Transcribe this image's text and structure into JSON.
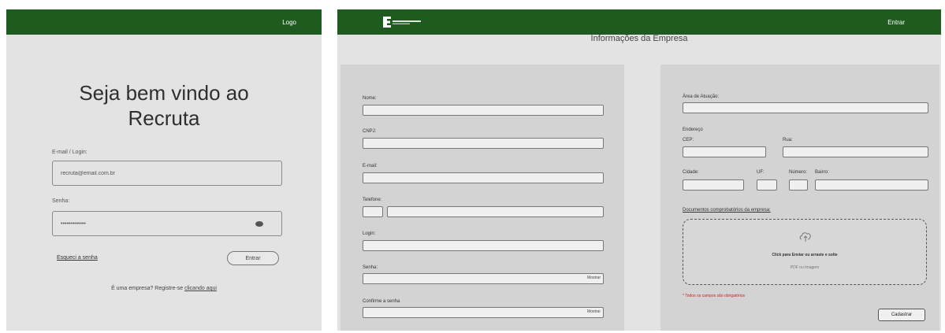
{
  "login": {
    "header": {
      "logo_label": "Logo"
    },
    "welcome": {
      "line1": "Seja bem vindo ao",
      "line2": "Recruta"
    },
    "email_label": "E-mail / Login:",
    "email_value": "recruta@email.com.br",
    "password_label": "Senha:",
    "password_value": "•••••••••••••",
    "forgot_label": "Esqueci a senha",
    "enter_label": "Entrar",
    "register_text": "É uma empresa? Registre-se",
    "register_link": "clicando aqui",
    "eye_icon": "eye-icon"
  },
  "company": {
    "header": {
      "enter_label": "Entrar",
      "brand_icon": "institution-logo-icon"
    },
    "title": "Informações da Empresa",
    "left_panel": {
      "name_label": "Nome:",
      "cnpj_label": "CNPJ:",
      "email_label": "E-mail:",
      "phone_label": "Telefone:",
      "login_label": "Login:",
      "password_label": "Senha:",
      "password_toggle": "Mostrar",
      "confirm_label": "Confirme a senha",
      "confirm_toggle": "Mostrar"
    },
    "right_panel": {
      "area_label": "Área de Atuação:",
      "address_label": "Endereço",
      "cep_label": "CEP:",
      "street_label": "Rua:",
      "city_label": "Cidade:",
      "uf_label": "UF:",
      "number_label": "Número:",
      "district_label": "Bairro:",
      "docs_label": "Documentos comprobatórios da empresa:",
      "upload_main": "Click para Enviar ou arraste e solte",
      "upload_sub": "PDF ou Imagem",
      "upload_icon": "upload-cloud-icon",
      "required_note": "* Todos os campos são obrigatórios",
      "submit_label": "Cadastrar"
    }
  },
  "colors": {
    "topbar": "#1f5b1f",
    "background": "#e3e3e3",
    "panel": "#d3d3d3",
    "required": "#cc2222"
  }
}
